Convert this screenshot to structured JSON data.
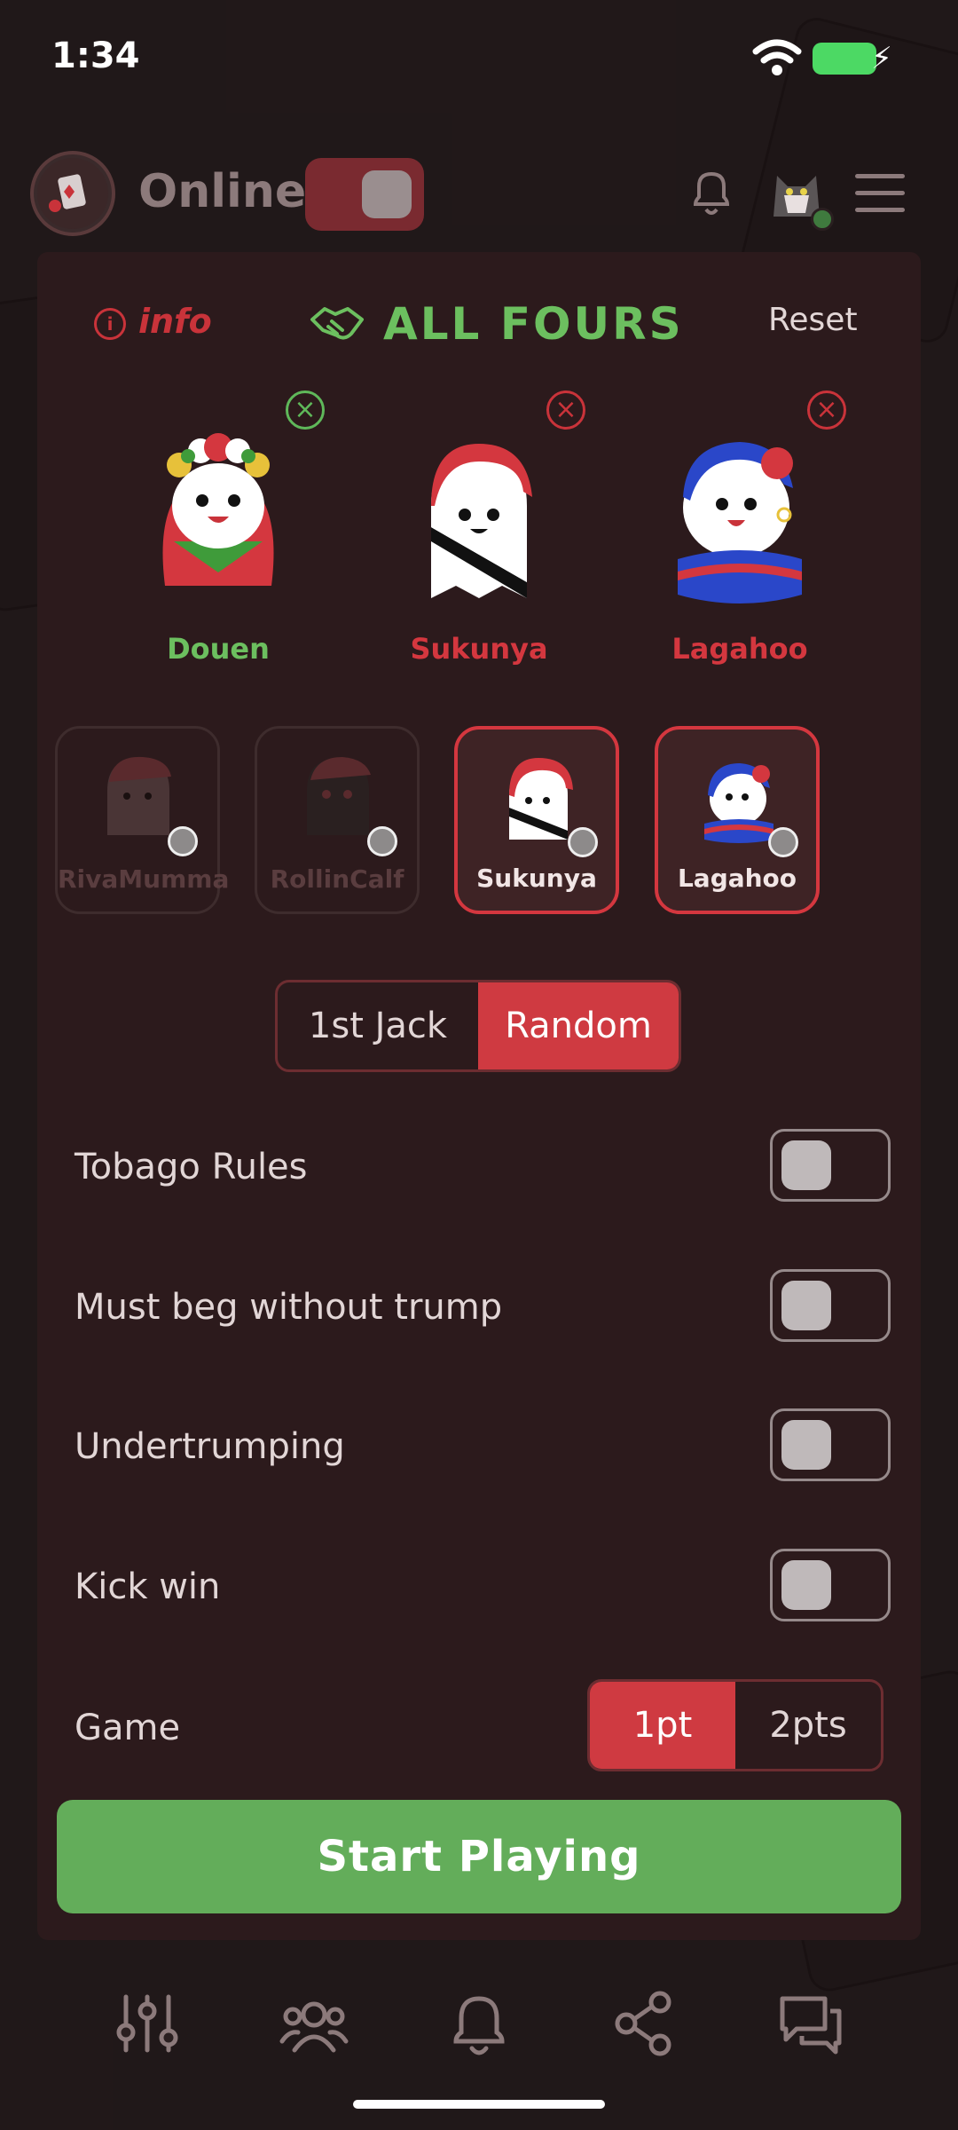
{
  "status_bar": {
    "time": "1:34"
  },
  "header": {
    "online_label": "Online"
  },
  "panel": {
    "info_label": "info",
    "title": "ALL FOURS",
    "reset_label": "Reset"
  },
  "selected_players": [
    {
      "name": "Douen",
      "color": "#6cbf5f"
    },
    {
      "name": "Sukunya",
      "color": "#d4373f"
    },
    {
      "name": "Lagahoo",
      "color": "#d4373f"
    }
  ],
  "roster": [
    {
      "name": "RivaMumma",
      "selected": false
    },
    {
      "name": "RollinCalf",
      "selected": false
    },
    {
      "name": "Sukunya",
      "selected": true
    },
    {
      "name": "Lagahoo",
      "selected": true
    }
  ],
  "deal_mode": {
    "options": [
      "1st Jack",
      "Random"
    ],
    "selected": "Random"
  },
  "rules": [
    {
      "label": "Tobago Rules",
      "on": false
    },
    {
      "label": "Must beg without trump",
      "on": false
    },
    {
      "label": "Undertrumping",
      "on": false
    },
    {
      "label": "Kick win",
      "on": false
    }
  ],
  "game": {
    "label": "Game",
    "options": [
      "1pt",
      "2pts"
    ],
    "selected": "1pt"
  },
  "start_button": "Start Playing",
  "bottom_nav": [
    "settings-sliders-icon",
    "players-icon",
    "bell-icon",
    "share-icon",
    "chat-icon"
  ],
  "colors": {
    "accent_red": "#cf3a41",
    "accent_green": "#63ad5a",
    "panel_bg": "#2c1a1c"
  }
}
